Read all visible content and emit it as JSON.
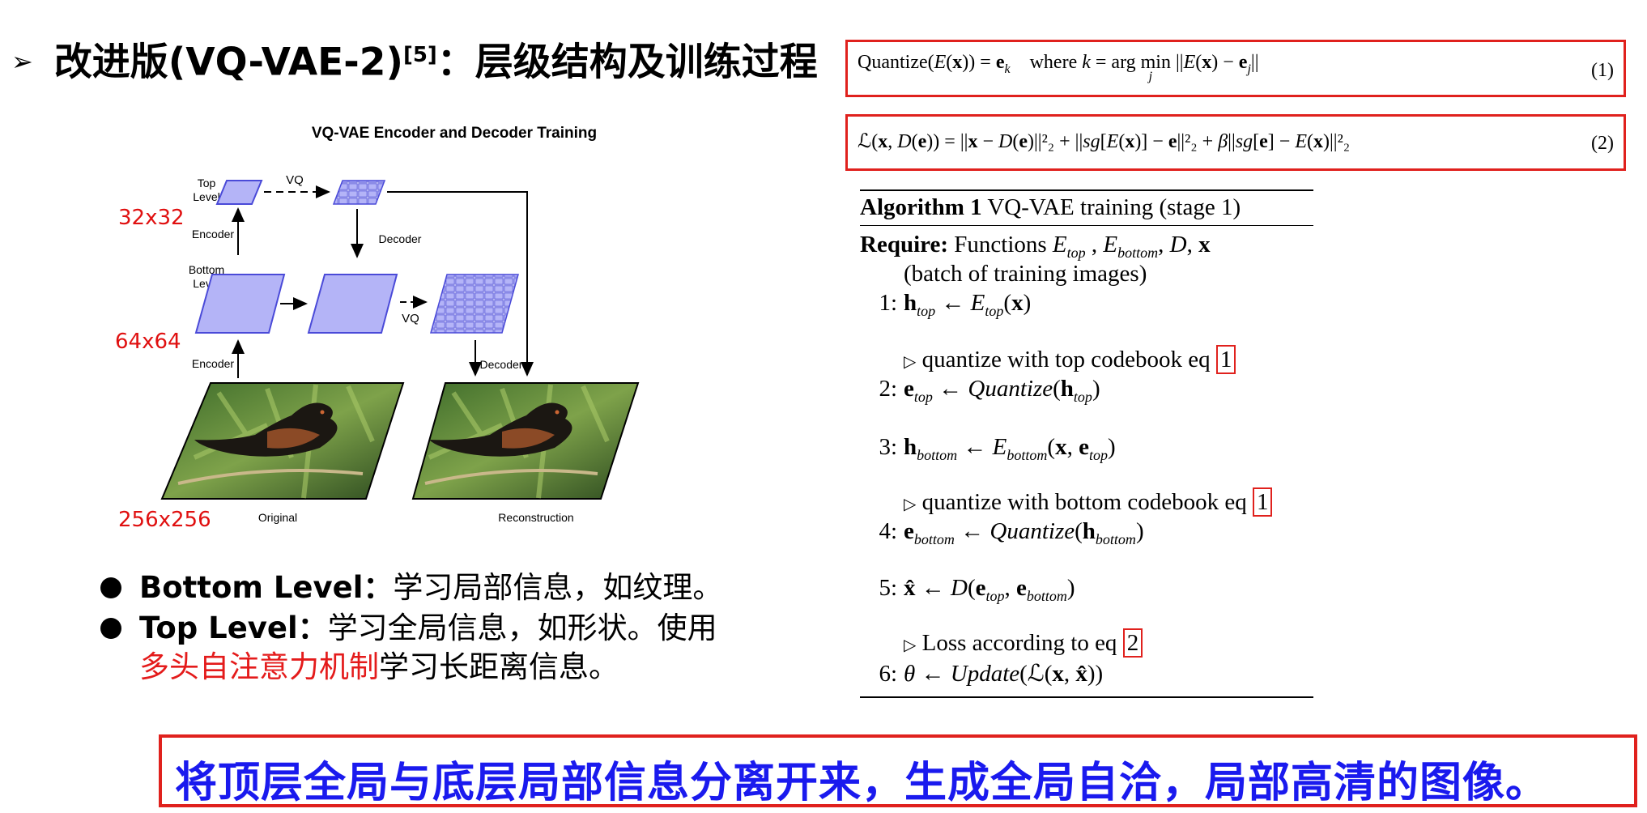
{
  "slide": {
    "title_bullet": "➢",
    "title_main": "改进版(VQ-VAE-2)",
    "title_sup": "[5]",
    "title_rest": "：层级结构及训练过程"
  },
  "diagram": {
    "title": "VQ-VAE Encoder and Decoder Training",
    "top_level": [
      "Top",
      "Level"
    ],
    "bottom_level": [
      "Bottom",
      "Level"
    ],
    "encoder": "Encoder",
    "decoder": "Decoder",
    "vq": "VQ",
    "original": "Original",
    "reconstruction": "Reconstruction",
    "size_top": "32x32",
    "size_bottom": "64x64",
    "size_image": "256x256",
    "colors": {
      "latent_fill": "#b4b4f7",
      "latent_stroke": "#4a4ad8",
      "size_label": "#e01010"
    }
  },
  "bullets": [
    {
      "label": "Bottom Level：",
      "text": "学习局部信息，如纹理。"
    },
    {
      "label": "Top Level：",
      "text": "学习全局信息，如形状。使用",
      "red": "多头自注意力机制",
      "text2": "学习长距离信息。"
    }
  ],
  "equations": [
    {
      "text": "Quantize(E(x)) = e_k  where k = arg min_j ||E(x) − e_j||",
      "number": "(1)"
    },
    {
      "text": "L(x, D(e)) = ||x − D(e)||²₂ + ||sg[E(x)] − e||²₂ + β||sg[e] − E(x)||²₂",
      "number": "(2)"
    }
  ],
  "algorithm": {
    "title_bold": "Algorithm 1",
    "title_rest": "VQ-VAE training (stage 1)",
    "require_bold": "Require:",
    "require_text": "Functions",
    "require_cont": "(batch of training images)",
    "comment1": "quantize with top codebook eq",
    "comment2": "quantize with bottom codebook eq",
    "comment3": "Loss according to eq",
    "ref1": "1",
    "ref2": "1",
    "ref3": "2",
    "line_numbers": [
      "1:",
      "2:",
      "3:",
      "4:",
      "5:",
      "6:"
    ]
  },
  "banner": {
    "text": "将顶层全局与底层局部信息分离开来，生成全局自洽，局部高清的图像。",
    "color": "#1a1aee",
    "border_color": "#e0211d"
  }
}
